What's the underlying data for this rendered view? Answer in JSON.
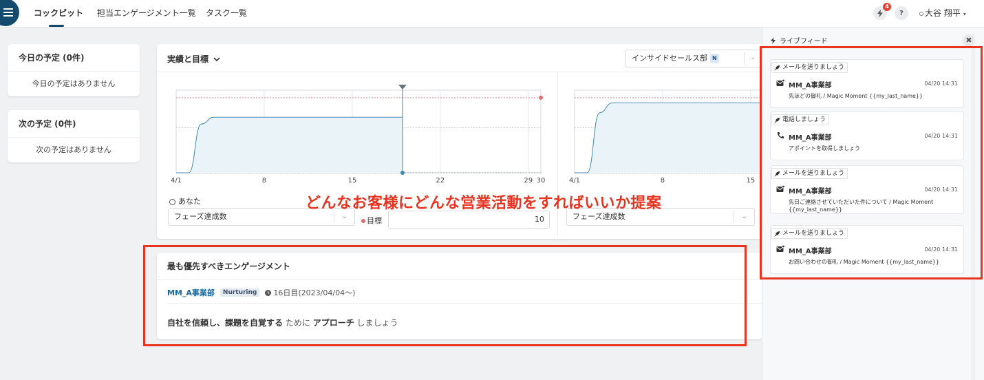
{
  "nav": {
    "tabs": [
      {
        "label": "コックピット",
        "active": true
      },
      {
        "label": "担当エンゲージメント一覧",
        "active": false
      },
      {
        "label": "タスク一覧",
        "active": false
      }
    ],
    "notification_count": "4",
    "help_icon_label": "?",
    "user_name": "大谷 翔平"
  },
  "schedule": {
    "today": {
      "title": "今日の予定 (0件)",
      "empty": "今日の予定はありません"
    },
    "next": {
      "title": "次の予定 (0件)",
      "empty": "次の予定はありません"
    }
  },
  "performance": {
    "title": "実績と目標",
    "department": "インサイドセールス部",
    "department_badge": "N",
    "you_label": "あなた",
    "left_metric": "フェーズ達成数",
    "goal_label": "目標",
    "goal_value": "10",
    "right_metric": "フェーズ達成数"
  },
  "chart_data": [
    {
      "type": "area",
      "x_ticks": [
        "4/1",
        "8",
        "15",
        "22",
        "29",
        "30"
      ],
      "x": [
        1,
        2,
        3,
        4,
        5,
        19
      ],
      "values": [
        0,
        0,
        6.5,
        7.4,
        7.4,
        7.4
      ],
      "goal": 10,
      "today_marker": 19,
      "ylim": [
        0,
        11
      ]
    },
    {
      "type": "area",
      "x_ticks": [
        "4/1",
        "8",
        "15"
      ],
      "x": [
        1,
        2,
        3,
        4,
        19
      ],
      "values": [
        0,
        0,
        8,
        9.3,
        9.3
      ],
      "goal": 10,
      "ylim": [
        0,
        11
      ]
    }
  ],
  "engagement": {
    "title": "最も優先すべきエンゲージメント",
    "company": "MM_A事業部",
    "phase": "Nurturing",
    "days": "16日目(2023/04/04〜)",
    "action_1": "自社を信頼し、課題を自覚する",
    "action_2": "ために",
    "action_3": "アプローチ",
    "action_4": "しましょう"
  },
  "feed": {
    "title": "ライブフィード",
    "close_label": "✖",
    "items": [
      {
        "tag": "メールを送りましょう",
        "icon": "mail-icon",
        "company": "MM_A事業部",
        "time": "04/20 14:31",
        "desc": "先ほどの御礼 / Magic Moment {{my_last_name}}"
      },
      {
        "tag": "電話しましょう",
        "icon": "phone-icon",
        "company": "MM_A事業部",
        "time": "04/20 14:31",
        "desc": "アポイントを取得しましょう"
      },
      {
        "tag": "メールを送りましょう",
        "icon": "mail-icon",
        "company": "MM_A事業部",
        "time": "04/20 14:31",
        "desc": "先日ご連絡させていただいた件について / Magic Moment {{my_last_name}}"
      },
      {
        "tag": "メールを送りましょう",
        "icon": "mail-icon",
        "company": "MM_A事業部",
        "time": "04/20 14:31",
        "desc": "お問い合わせの御礼 / Magic Moment {{my_last_name}}"
      }
    ]
  },
  "annotation": {
    "text": "どんなお客様にどんな営業活動をすればいいか提案",
    "color": "#e8331f"
  }
}
